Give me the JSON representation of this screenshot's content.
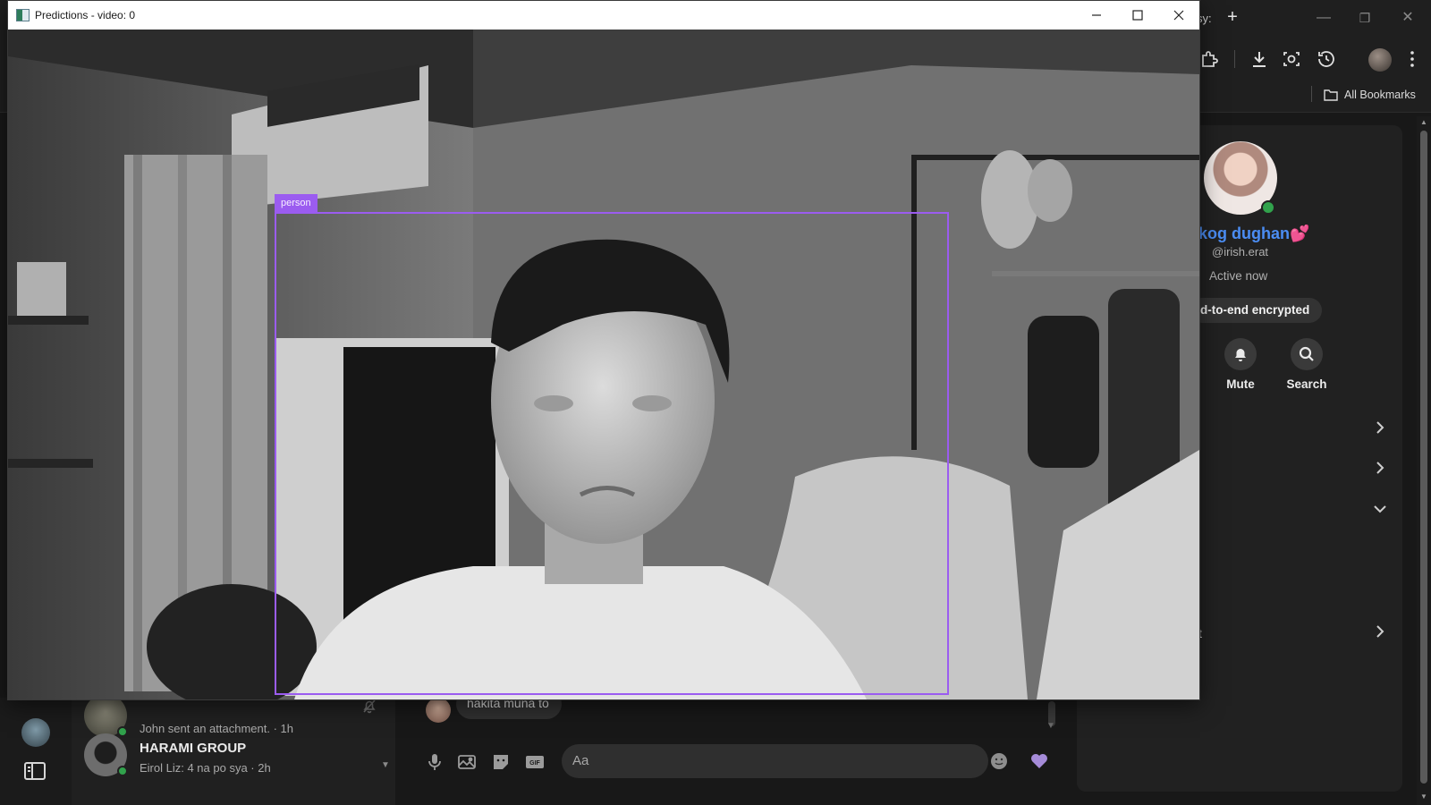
{
  "browser": {
    "tab_fragment": "sy:",
    "bookmarks_label": "All Bookmarks"
  },
  "messenger": {
    "chats": [
      {
        "name": "",
        "preview": "John sent an attachment. · 1h",
        "online": true,
        "muted": true
      },
      {
        "name": "HARAMI GROUP",
        "preview": "Eirol Liz: 4 na po sya · 2h",
        "online": true,
        "muted": false
      }
    ],
    "message_bubble": "hakita muna to",
    "composer_placeholder": "Aa",
    "profile": {
      "name": "kog dughan💕",
      "handle": "@irish.erat",
      "status": "Active now",
      "encryption": "d-to-end encrypted",
      "actions": [
        {
          "label": "Mute",
          "icon": "bell-icon"
        },
        {
          "label": "Search",
          "icon": "search-icon"
        }
      ],
      "row_fragment": "t"
    },
    "accent_color": "#4b8df3"
  },
  "predictions_window": {
    "title": "Predictions - video: 0",
    "detection": {
      "label": "person",
      "box_color": "#9b5cf0"
    }
  }
}
